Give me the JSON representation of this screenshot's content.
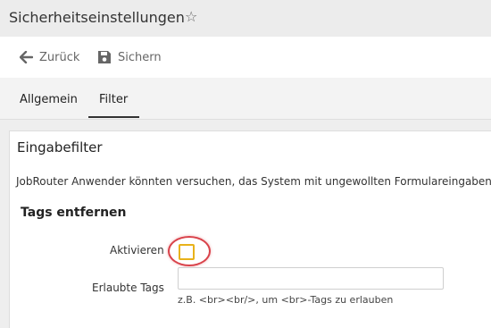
{
  "window": {
    "title": "Sicherheitseinstellungen",
    "favorite_icon": "star-outline-icon"
  },
  "toolbar": {
    "back_label": "Zurück",
    "back_icon": "arrow-left-icon",
    "save_label": "Sichern",
    "save_icon": "floppy-disk-icon"
  },
  "tabs": [
    {
      "label": "Allgemein",
      "active": false
    },
    {
      "label": "Filter",
      "active": true
    }
  ],
  "section": {
    "title": "Eingabefilter",
    "description": "JobRouter Anwender könnten versuchen, das System mit ungewollten Formulareingaben",
    "subsection_title": "Tags entfernen",
    "activate_label": "Aktivieren",
    "activate_checked": false,
    "allowed_tags_label": "Erlaubte Tags",
    "allowed_tags_value": "",
    "allowed_tags_hint": "z.B. <br><br/>, um <br>-Tags zu erlauben"
  },
  "colors": {
    "checkbox_border": "#e8b21a",
    "highlight_ring": "#d9434b",
    "tab_underline": "#333333"
  }
}
